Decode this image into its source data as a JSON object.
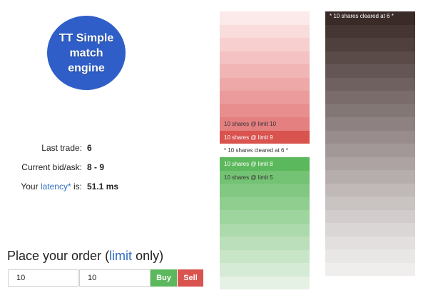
{
  "logo": {
    "title": "TT Simple match engine"
  },
  "stats": {
    "last_trade": {
      "label": "Last trade:",
      "value": "6"
    },
    "bid_ask": {
      "label": "Current bid/ask:",
      "value": "8 - 9"
    },
    "latency": {
      "prefix": "Your ",
      "link": "latency*",
      "suffix": " is:",
      "value": "51.1 ms"
    }
  },
  "order": {
    "title_prefix": "Place your order (",
    "title_link": "limit",
    "title_suffix": " only)",
    "quantity_value": "10",
    "price_value": "10",
    "buy_label": "Buy",
    "sell_label": "Sell"
  },
  "order_book": {
    "asks": [
      {
        "text": "",
        "bg": "#fce9e9",
        "fg": "#333333"
      },
      {
        "text": "",
        "bg": "#f9dcdc",
        "fg": "#333333"
      },
      {
        "text": "",
        "bg": "#f7cfcf",
        "fg": "#333333"
      },
      {
        "text": "",
        "bg": "#f4c2c2",
        "fg": "#333333"
      },
      {
        "text": "",
        "bg": "#f1b5b5",
        "fg": "#333333"
      },
      {
        "text": "",
        "bg": "#eea8a8",
        "fg": "#333333"
      },
      {
        "text": "",
        "bg": "#eb9b9b",
        "fg": "#333333"
      },
      {
        "text": "",
        "bg": "#e88e8e",
        "fg": "#333333"
      },
      {
        "text": "10 shares @ limit 10",
        "bg": "#e48080",
        "fg": "#333333"
      },
      {
        "text": "10 shares @ limit 9",
        "bg": "#d9534f",
        "fg": "#ffffff"
      }
    ],
    "cleared": "* 10 shares cleared at 6 *",
    "bids": [
      {
        "text": "10 shares @ limit 8",
        "bg": "#5cb85c",
        "fg": "#ffffff"
      },
      {
        "text": "10 shares @ limit 5",
        "bg": "#74c274",
        "fg": "#333333"
      },
      {
        "text": "",
        "bg": "#82c882",
        "fg": "#333333"
      },
      {
        "text": "",
        "bg": "#90ce90",
        "fg": "#333333"
      },
      {
        "text": "",
        "bg": "#9ed49e",
        "fg": "#333333"
      },
      {
        "text": "",
        "bg": "#acdaac",
        "fg": "#333333"
      },
      {
        "text": "",
        "bg": "#badfba",
        "fg": "#333333"
      },
      {
        "text": "",
        "bg": "#c8e5c8",
        "fg": "#333333"
      },
      {
        "text": "",
        "bg": "#d6ebd6",
        "fg": "#333333"
      },
      {
        "text": "",
        "bg": "#e4f1e4",
        "fg": "#333333"
      }
    ]
  },
  "trade_history": {
    "rows": [
      {
        "text": "* 10 shares cleared at 6 *",
        "bg": "#3a2a28"
      },
      {
        "text": "",
        "bg": "#453634"
      },
      {
        "text": "",
        "bg": "#4f403e"
      },
      {
        "text": "",
        "bg": "#5a4b49"
      },
      {
        "text": "",
        "bg": "#645654"
      },
      {
        "text": "",
        "bg": "#6e615f"
      },
      {
        "text": "",
        "bg": "#796c6a"
      },
      {
        "text": "",
        "bg": "#837775"
      },
      {
        "text": "",
        "bg": "#8d8281"
      },
      {
        "text": "",
        "bg": "#988d8c"
      },
      {
        "text": "",
        "bg": "#a29897"
      },
      {
        "text": "",
        "bg": "#aca3a2"
      },
      {
        "text": "",
        "bg": "#b6aead"
      },
      {
        "text": "",
        "bg": "#c0b9b8"
      },
      {
        "text": "",
        "bg": "#c9c3c2"
      },
      {
        "text": "",
        "bg": "#d2cdcc"
      },
      {
        "text": "",
        "bg": "#dad6d5"
      },
      {
        "text": "",
        "bg": "#e2dfde"
      },
      {
        "text": "",
        "bg": "#e9e7e6"
      },
      {
        "text": "",
        "bg": "#efeeed"
      }
    ]
  }
}
